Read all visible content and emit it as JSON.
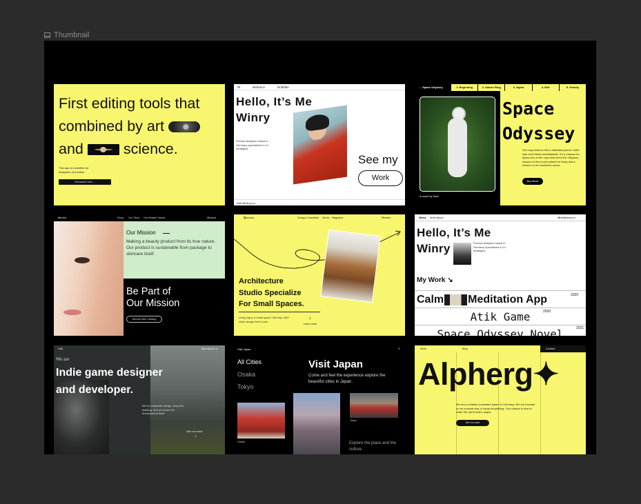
{
  "frame": {
    "label": "Thumbnail"
  },
  "cards": {
    "c1": {
      "line1": "First editing tools that",
      "line2a": "combined by art",
      "line3a": "and",
      "line3b": "science.",
      "small": "This app is incredible for designers and artists.",
      "button": "Get found it now"
    },
    "c2": {
      "nav": [
        "W",
        "Behance",
        "Dribbble"
      ],
      "heading_line1": "Hello, It’s Me",
      "heading_line2": "Winry",
      "blurb": "Product designer based in Germany specialized in UI strategies.",
      "see": "See my",
      "work_button": "Work",
      "email": "hello@winry.co"
    },
    "c3": {
      "tabs": [
        "Space Odyssey",
        "1. Beginning",
        "2. Saturn Ring",
        "3. Alpha",
        "4. Exit",
        "5. Gravity"
      ],
      "title_line1": "Space",
      "title_line2": "Odyssey",
      "description": "One way ticket to find a habitable planet. Earth was most likely uninhabitable. It's a mission for Alpha who is the only crew left in the Odyssey mission to find a new planet for living and a mission to be mankind's savior.",
      "buy": "Buy Book",
      "novel": "A novel by Sam"
    },
    "c4": {
      "brand": "Neutral Skin",
      "nav": [
        "Shop",
        "Our Story",
        "Our Beauty Values"
      ],
      "contact": "Contact",
      "mission_title": "Our Mission",
      "mission_text": "Making a beauty product from its true nature. Our product is sustainable from package to skincare itself.",
      "be_part_line1": "Be Part of",
      "be_part_line2": "Our Mission",
      "catalog": "Neutral Skin Catalog"
    },
    "c5": {
      "brand": "Structura",
      "nav": [
        "Design Consultant",
        "Works",
        "Magazine"
      ],
      "contact": "Contact",
      "heading_line1": "Architecture",
      "heading_line2": "Studio Specialize",
      "heading_line3": "For Small Spaces.",
      "note": "Living big in a small space. We help 180+ client design their home.",
      "learn": "Learn more"
    },
    "c6": {
      "nav_brand": "Winry",
      "nav_links": "Work  About",
      "email": "Hello@winry.co",
      "heading_line1": "Hello, It’s Me",
      "heading_line2": "Winry",
      "blurb": "Product designer based in Germany specialized in UI strategies.",
      "my_work": "My Work",
      "project1a": "Calm",
      "project1b": "Meditation App",
      "year1": "2020",
      "project2": "Atik Game",
      "year2": "2020",
      "project3": "Space Odyssey Novel",
      "year3": "2021"
    },
    "c7": {
      "brand": "Atik",
      "email": "hello@atik.co",
      "we_are": "We are",
      "line1": "Indie game designer",
      "line2": "and developer.",
      "description": "We do character design, story line building, and of course the development itself.",
      "see_work": "See our work"
    },
    "c8": {
      "brand": "Visit Japan",
      "cities": [
        "All Cities",
        "Osaka",
        "Tokyo"
      ],
      "title": "Visit Japan",
      "subtitle": "Come and feel the experience explore the beautiful cities in Japan.",
      "cap1": "Osaka",
      "cap3": "Tokyo",
      "explore": "Explore the place and the culture."
    },
    "c9": {
      "nav": [
        "Work",
        "Blog"
      ],
      "contact": "Contact",
      "name": "Alpherg",
      "star": "✦",
      "description": "We are a creative consultant based in Germany. We are focused on an unusual way of visual storytelling. Our mission is how to make the client looks unique.",
      "button": "See our work"
    }
  }
}
